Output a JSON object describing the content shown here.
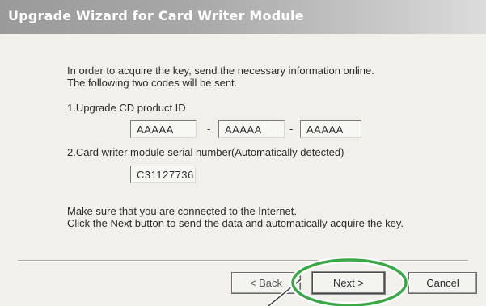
{
  "window": {
    "title": "Upgrade Wizard for Card Writer Module"
  },
  "intro": {
    "line1": "In order to acquire the key, send the necessary information online.",
    "line2": "The following two codes will be sent."
  },
  "product_id": {
    "label": "1.Upgrade CD product ID",
    "fields": [
      "AAAAA",
      "AAAAA",
      "AAAAA"
    ],
    "separator": "-"
  },
  "serial": {
    "label": "2.Card writer module serial number(Automatically detected)",
    "value": "C31127736"
  },
  "notice": {
    "line1": "Make sure that you are connected to the Internet.",
    "line2": "Click the Next button to send the data and automatically acquire the key."
  },
  "buttons": {
    "back": "< Back",
    "next": "Next >",
    "cancel": "Cancel"
  },
  "colors": {
    "highlight_circle": "#3aa845",
    "titlebar_start": "#9a9a9a",
    "titlebar_end": "#dcdcdc"
  }
}
